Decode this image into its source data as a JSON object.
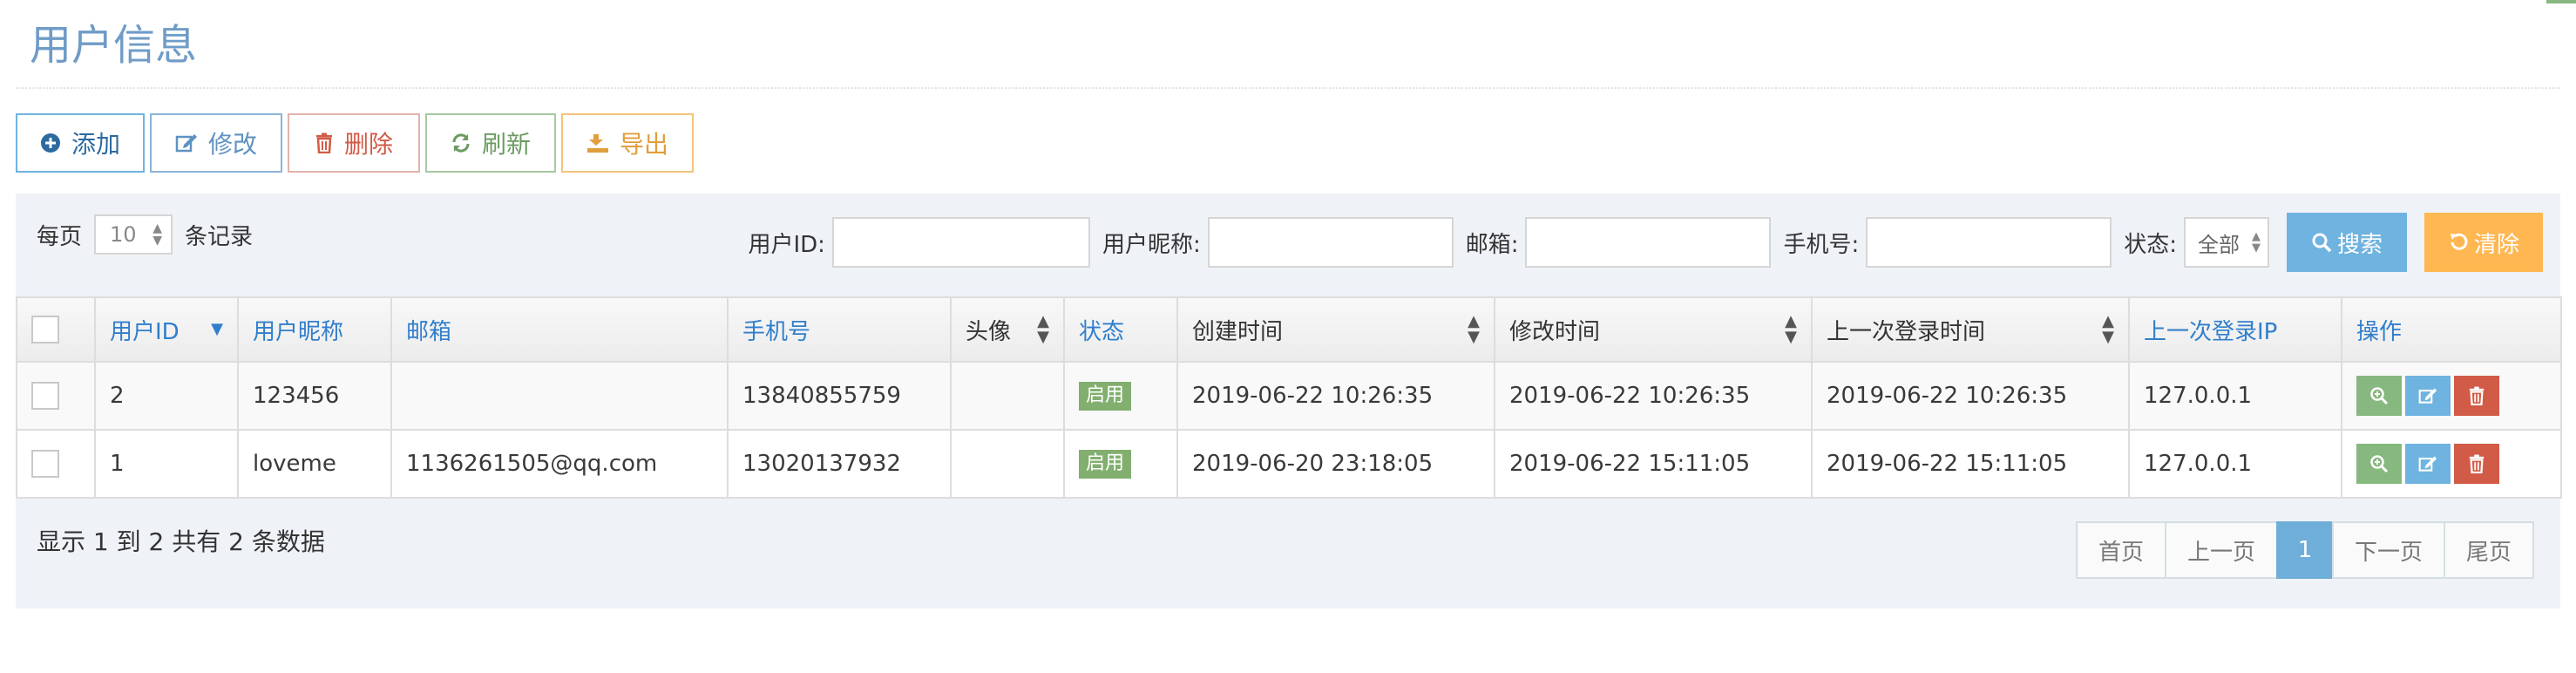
{
  "page": {
    "title": "用户信息"
  },
  "toolbar": {
    "add": "添加",
    "edit": "修改",
    "delete": "删除",
    "refresh": "刷新",
    "export": "导出"
  },
  "length_menu": {
    "prefix": "每页",
    "value": "10",
    "suffix": "条记录"
  },
  "filters": {
    "user_id_label": "用户ID:",
    "nickname_label": "用户昵称:",
    "email_label": "邮箱:",
    "phone_label": "手机号:",
    "status_label": "状态:",
    "status_value": "全部",
    "search_button": "搜索",
    "clear_button": "清除"
  },
  "table": {
    "columns": [
      "用户ID",
      "用户昵称",
      "邮箱",
      "手机号",
      "头像",
      "状态",
      "创建时间",
      "修改时间",
      "上一次登录时间",
      "上一次登录IP",
      "操作"
    ],
    "rows": [
      {
        "id": "2",
        "nickname": "123456",
        "email": "",
        "phone": "13840855759",
        "avatar": "",
        "status": "启用",
        "created": "2019-06-22 10:26:35",
        "modified": "2019-06-22 10:26:35",
        "last_login": "2019-06-22 10:26:35",
        "last_ip": "127.0.0.1"
      },
      {
        "id": "1",
        "nickname": "loveme",
        "email": "1136261505@qq.com",
        "phone": "13020137932",
        "avatar": "",
        "status": "启用",
        "created": "2019-06-20 23:18:05",
        "modified": "2019-06-22 15:11:05",
        "last_login": "2019-06-22 15:11:05",
        "last_ip": "127.0.0.1"
      }
    ]
  },
  "footer": {
    "info": "显示 1 到 2 共有 2 条数据"
  },
  "pagination": {
    "first": "首页",
    "prev": "上一页",
    "current": "1",
    "next": "下一页",
    "last": "尾页"
  },
  "colors": {
    "accent_blue": "#6fb3e0",
    "header_blue": "#307ecc",
    "success": "#82af6f",
    "danger": "#d15b47",
    "warning": "#ffb752",
    "panel_bg": "#eff3f8"
  }
}
